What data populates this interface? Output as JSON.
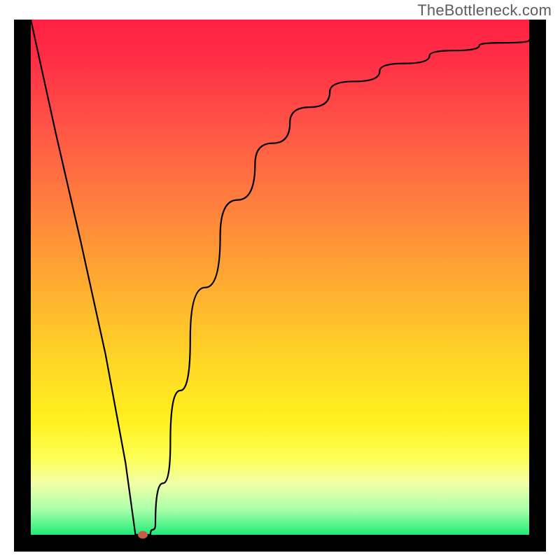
{
  "attribution": "TheBottleneck.com",
  "colors": {
    "frame": "#000000",
    "curve": "#000000",
    "marker": "#c85a4a",
    "gradient_top": "#ff2042",
    "gradient_mid": "#ffd626",
    "gradient_bottom": "#22e37a"
  },
  "chart_data": {
    "type": "line",
    "title": "",
    "xlabel": "",
    "ylabel": "",
    "xlim": [
      0,
      100
    ],
    "ylim": [
      0,
      100
    ],
    "x": [
      0,
      5,
      10,
      15,
      19,
      21,
      23,
      24,
      25,
      28,
      32,
      38,
      45,
      52,
      60,
      70,
      80,
      90,
      100
    ],
    "values": [
      100,
      78,
      57,
      35,
      14,
      0,
      0,
      0,
      2,
      18,
      38,
      58,
      72,
      80,
      86,
      90,
      93,
      95,
      96
    ],
    "flat_bottom_x_range": [
      21,
      23
    ],
    "marker": {
      "x": 22.5,
      "y": 0
    }
  }
}
